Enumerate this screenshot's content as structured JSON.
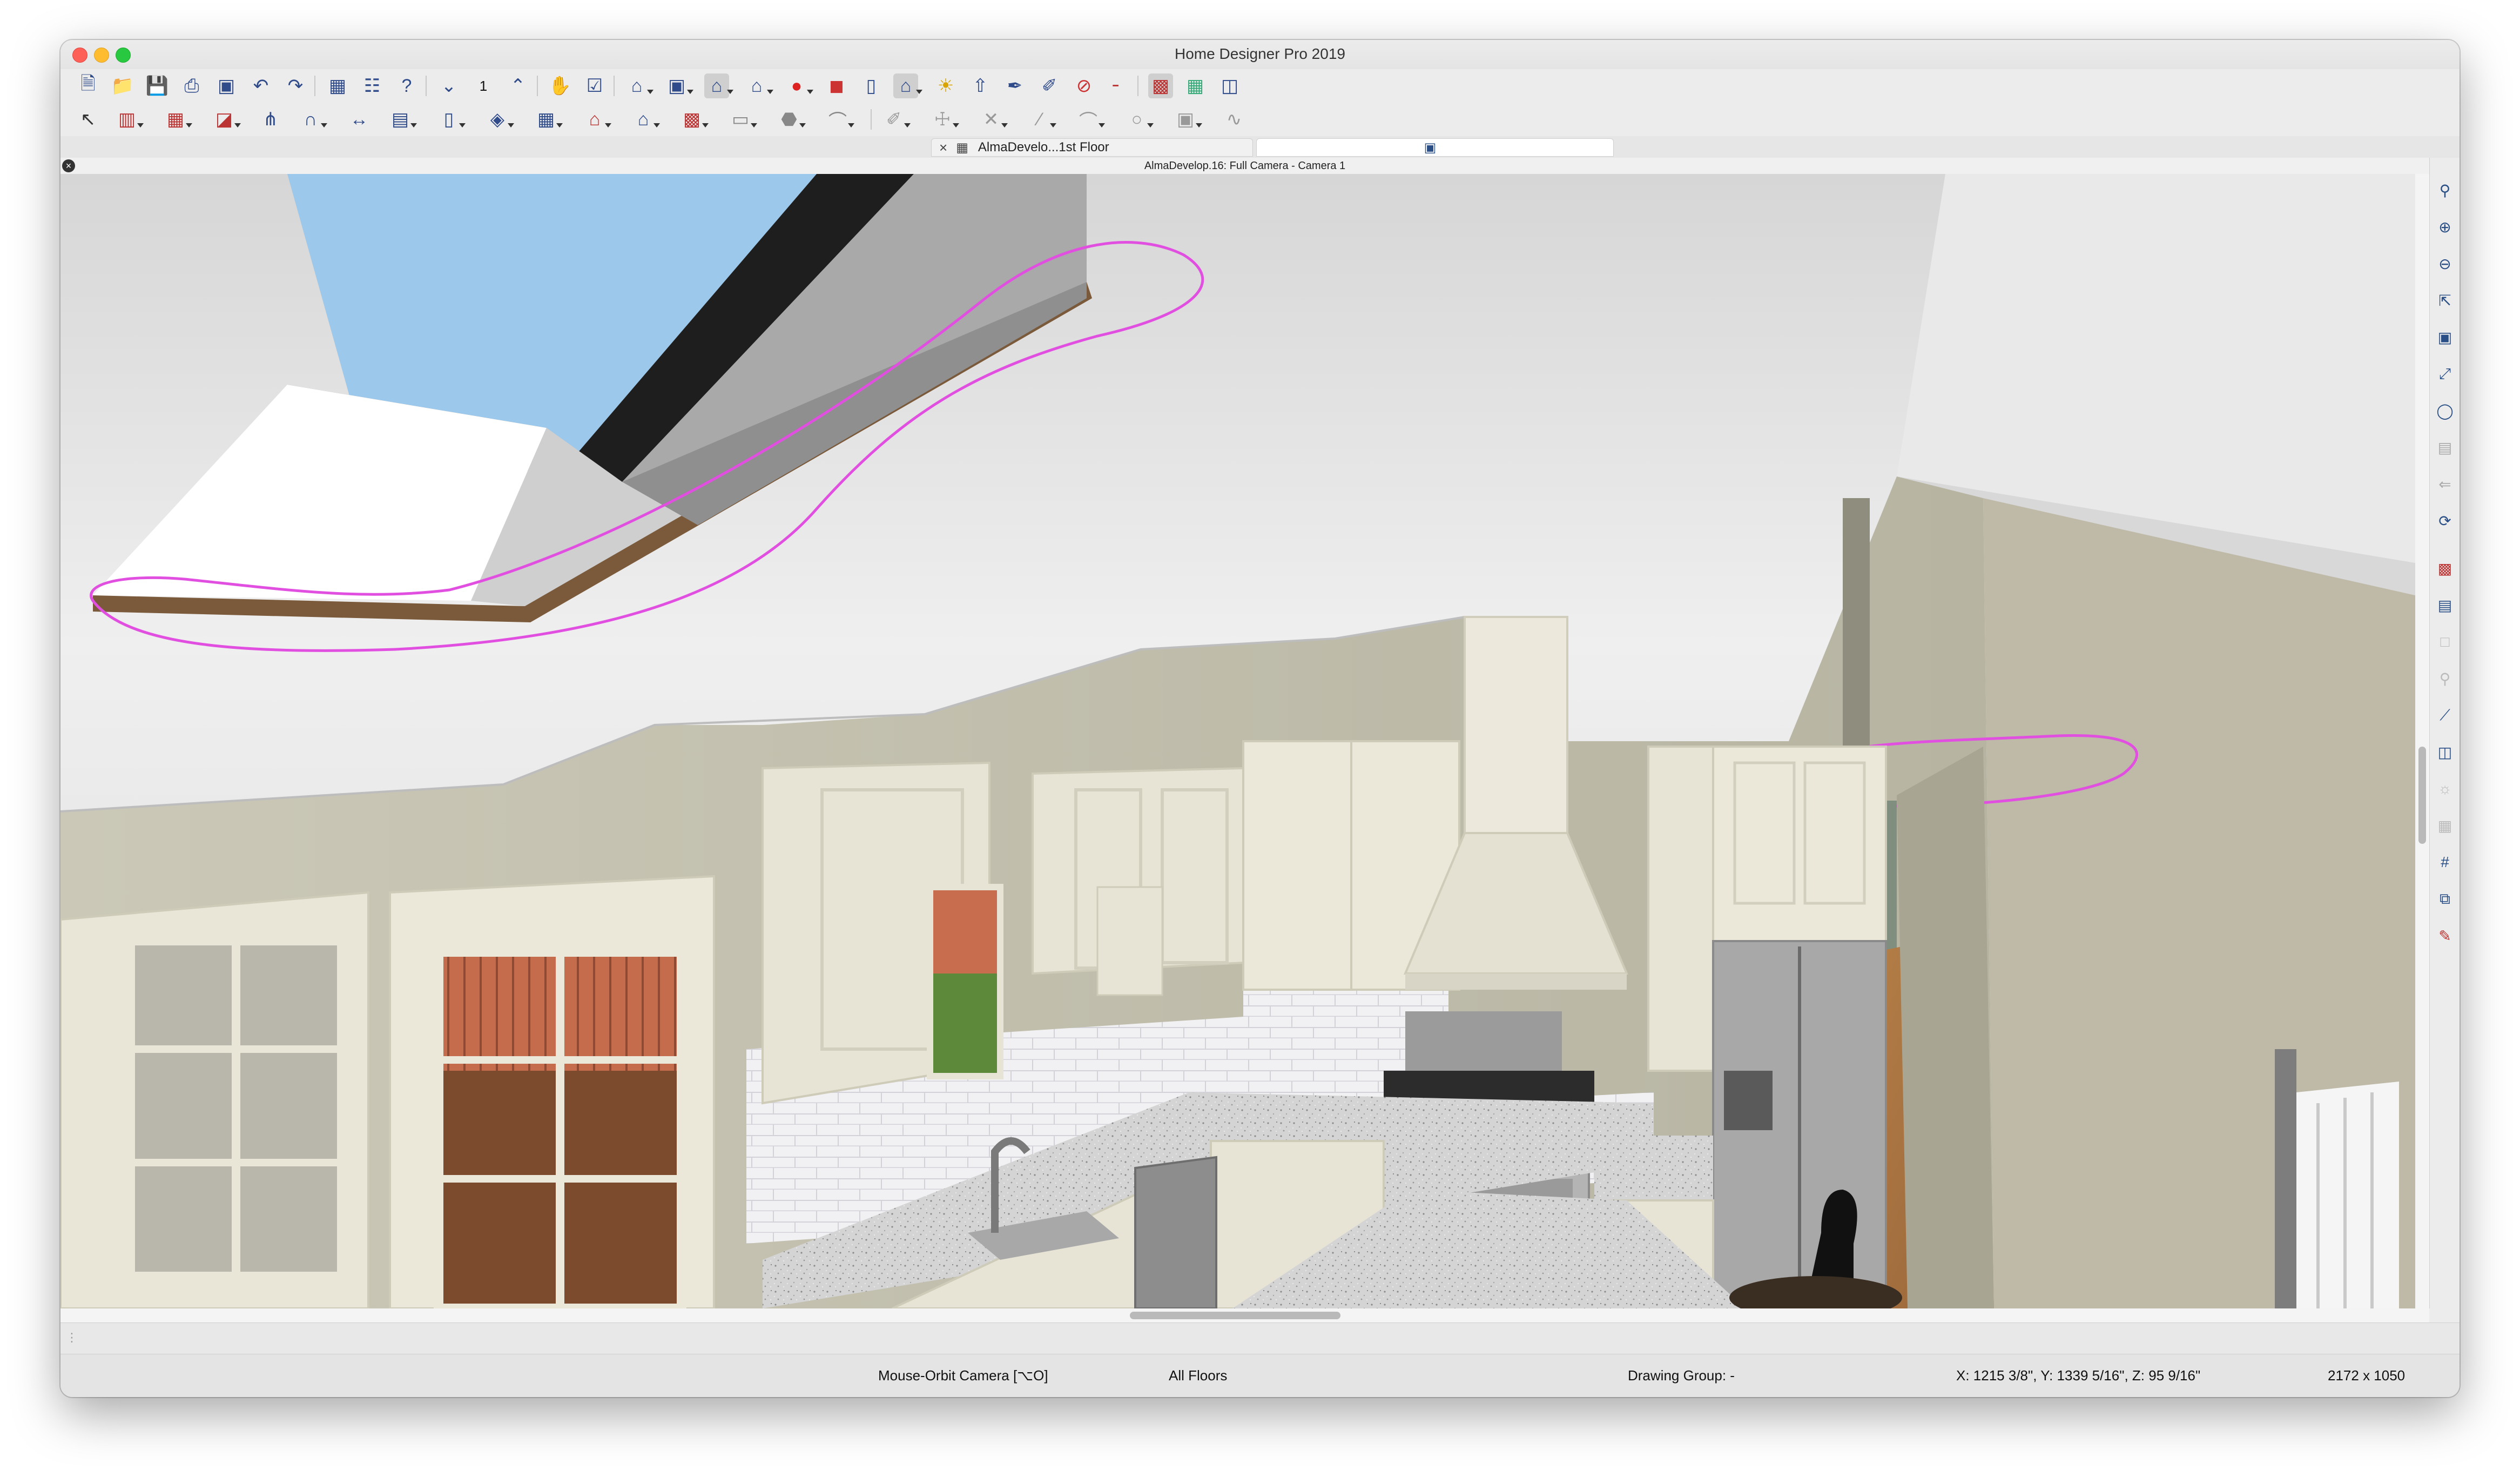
{
  "window": {
    "title": "Home Designer Pro 2019"
  },
  "toolbar_top": {
    "floor_number": "1"
  },
  "tabs": [
    {
      "label": "AlmaDevelo...1st Floor"
    },
    {
      "label": ""
    }
  ],
  "view": {
    "title": "AlmaDevelop.16: Full Camera - Camera 1"
  },
  "status": {
    "mode": "Mouse-Orbit Camera [⌥O]",
    "floors": "All Floors",
    "drawing_group": "Drawing Group: -",
    "coordinates": "X: 1215 3/8\", Y: 1339 5/16\", Z: 95 9/16\"",
    "dimensions": "2172 x 1050"
  },
  "colors": {
    "annotation": "#e14fe0",
    "wall": "#c7c4b0",
    "ceiling": "#ededed",
    "cabinet": "#e7e4d6",
    "floor": "#b07a44",
    "sky": "#9cc8ec",
    "toolbar_icon": "#2f4b8a"
  },
  "icons": {
    "top_toolbar": [
      "new-doc-icon",
      "open-folder-icon",
      "save-icon",
      "print-icon",
      "presentation-icon",
      "undo-icon",
      "redo-icon",
      "floor-plan-icon",
      "library-icon",
      "help-icon",
      "down-floor-icon",
      "up-floor-icon",
      "hand-icon",
      "checklist-icon",
      "elevation-icon",
      "camera-icon",
      "orbit-camera-icon",
      "doll-house-icon",
      "record-icon",
      "render-icon",
      "delete-icon",
      "home-icon",
      "light-icon",
      "export-icon",
      "pen-icon",
      "pencil-icon",
      "no-icon",
      "ruler-icon",
      "materials-icon",
      "panel-icon",
      "window-tile-icon"
    ],
    "bottom_toolbar": [
      "select-icon",
      "wall-icon",
      "cabinet-icon",
      "door-icon",
      "window-icon",
      "stair-icon",
      "dimension-icon",
      "shelf-icon",
      "roof-icon",
      "terrain-icon",
      "plant-icon",
      "house-icon",
      "house-outline-icon",
      "brick-icon",
      "slab-icon",
      "box-icon",
      "arc-icon",
      "text-icon",
      "cross-icon",
      "line-icon",
      "curve-icon",
      "circle-icon",
      "picture-icon",
      "spline-icon"
    ],
    "right_toolbar": [
      "zoom-icon",
      "zoom-in-icon",
      "zoom-out-icon",
      "resize-icon",
      "fit-icon",
      "fill-window-icon",
      "orbit-icon",
      "layer-icon",
      "walk-icon",
      "rotate-icon",
      "camera-settings-icon",
      "material-icon",
      "blank-icon",
      "search-icon",
      "line-measure-icon",
      "layers-icon",
      "sun-icon",
      "grid-tile-icon",
      "hash-grid-icon",
      "crop-icon",
      "edit-shape-icon"
    ]
  }
}
